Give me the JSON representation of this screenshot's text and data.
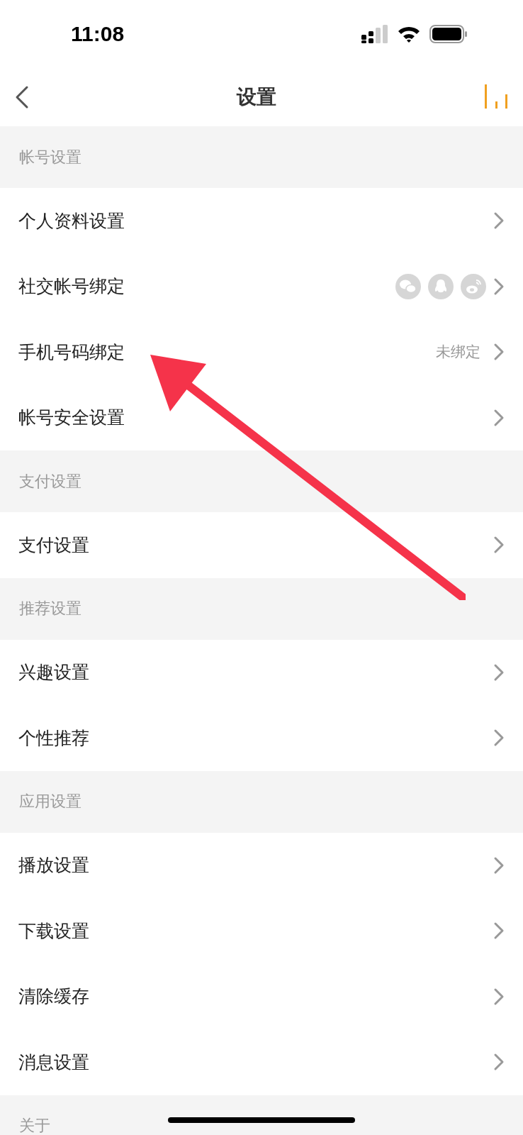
{
  "status_bar": {
    "time": "11:08"
  },
  "nav": {
    "title": "设置"
  },
  "sections": [
    {
      "title": "帐号设置",
      "items": [
        {
          "label": "个人资料设置",
          "kind": "plain"
        },
        {
          "label": "社交帐号绑定",
          "kind": "social"
        },
        {
          "label": "手机号码绑定",
          "kind": "value",
          "value": "未绑定"
        },
        {
          "label": "帐号安全设置",
          "kind": "plain"
        }
      ]
    },
    {
      "title": "支付设置",
      "items": [
        {
          "label": "支付设置",
          "kind": "plain"
        }
      ]
    },
    {
      "title": "推荐设置",
      "items": [
        {
          "label": "兴趣设置",
          "kind": "plain"
        },
        {
          "label": "个性推荐",
          "kind": "plain"
        }
      ]
    },
    {
      "title": "应用设置",
      "items": [
        {
          "label": "播放设置",
          "kind": "plain"
        },
        {
          "label": "下载设置",
          "kind": "plain"
        },
        {
          "label": "清除缓存",
          "kind": "plain"
        },
        {
          "label": "消息设置",
          "kind": "plain"
        }
      ]
    },
    {
      "title": "关于"
    }
  ]
}
